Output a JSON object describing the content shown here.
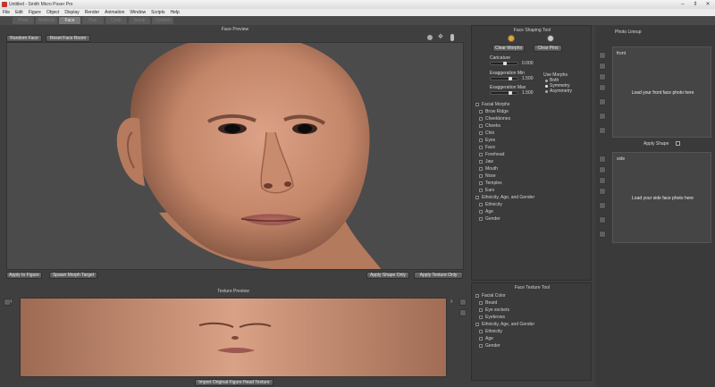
{
  "window": {
    "title": "Untitled - Smith Micro Poser Pro"
  },
  "menu": [
    "File",
    "Edit",
    "Figure",
    "Object",
    "Display",
    "Render",
    "Animation",
    "Window",
    "Scripts",
    "Help"
  ],
  "tabs": [
    "Pose",
    "Material",
    "Face",
    "Hair",
    "Cloth",
    "Setup",
    "Content"
  ],
  "active_tab": "Face",
  "face_preview": {
    "title": "Face Preview",
    "random_face": "Random Face",
    "reset_face_room": "Reset Face Room",
    "apply_to_figure": "Apply to Figure",
    "spawn_morph_target": "Spawn Morph Target",
    "apply_shape_only": "Apply Shape Only",
    "apply_texture_only": "Apply Texture Only"
  },
  "texture_preview": {
    "title": "Texture Preview",
    "import_button": "Import Original Figure Head Texture"
  },
  "shaping_tool": {
    "title": "Face Shaping Tool",
    "clear_morphs": "Clear Morphs",
    "clear_pins": "Clear Pins",
    "caricature_label": "Caricature",
    "caricature_value": "0.000",
    "exag_min_label": "Exaggeration Min",
    "exag_min_value": "1.500",
    "exag_max_label": "Exaggeration Max",
    "exag_max_value": "1.500",
    "use_morphs": "Use Morphs",
    "radio_both": "Both",
    "radio_symmetry": "Symmetry",
    "radio_asymmetry": "Asymmetry",
    "tree": [
      {
        "label": "Facial Morphs",
        "level": 0
      },
      {
        "label": "Brow Ridge",
        "level": 1
      },
      {
        "label": "Cheekbones",
        "level": 1
      },
      {
        "label": "Cheeks",
        "level": 1
      },
      {
        "label": "Chin",
        "level": 1
      },
      {
        "label": "Eyes",
        "level": 1
      },
      {
        "label": "Face",
        "level": 1
      },
      {
        "label": "Forehead",
        "level": 1
      },
      {
        "label": "Jaw",
        "level": 1
      },
      {
        "label": "Mouth",
        "level": 1
      },
      {
        "label": "Nose",
        "level": 1
      },
      {
        "label": "Temples",
        "level": 1
      },
      {
        "label": "Ears",
        "level": 1
      },
      {
        "label": "Ethnicity, Age, and Gender",
        "level": 0
      },
      {
        "label": "Ethnicity",
        "level": 1
      },
      {
        "label": "Age",
        "level": 1
      },
      {
        "label": "Gender",
        "level": 1
      }
    ]
  },
  "texture_tool": {
    "title": "Face Texture Tool",
    "tree": [
      {
        "label": "Facial Color",
        "level": 0
      },
      {
        "label": "Beard",
        "level": 1
      },
      {
        "label": "Eye sockets",
        "level": 1
      },
      {
        "label": "Eyebrows",
        "level": 1
      },
      {
        "label": "Ethnicity, Age, and Gender",
        "level": 0
      },
      {
        "label": "Ethnicity",
        "level": 1
      },
      {
        "label": "Age",
        "level": 1
      },
      {
        "label": "Gender",
        "level": 1
      }
    ]
  },
  "photo_lineup": {
    "title": "Photo Lineup",
    "front_label": "front",
    "front_msg": "Load your front face photo here",
    "apply_shape": "Apply Shape",
    "side_label": "side",
    "side_msg": "Load your side face photo here"
  },
  "colors": {
    "background": "#3f3f3f",
    "skin": "#c58a6c",
    "panel": "#3b3b3b"
  }
}
